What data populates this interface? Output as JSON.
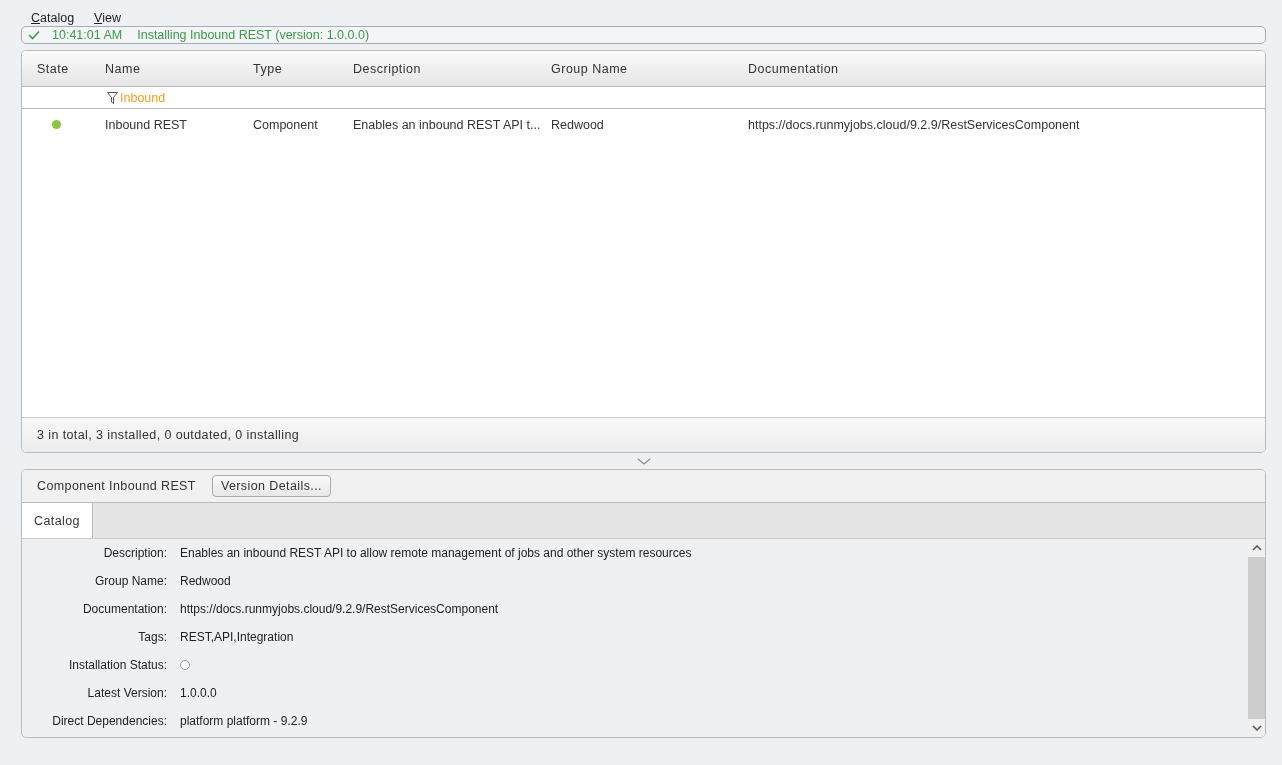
{
  "menu": [
    {
      "label": "Catalog"
    },
    {
      "label": "View"
    }
  ],
  "status_message": {
    "ok": true,
    "time": "10:41:01 AM",
    "text": "Installing Inbound REST (version: 1.0.0.0)"
  },
  "table": {
    "columns": [
      "State",
      "Name",
      "Type",
      "Description",
      "Group Name",
      "Documentation"
    ],
    "filter": "Inbound",
    "rows": [
      {
        "cells": [
          {
            "kind": "dot",
            "color": "#8cc63f"
          },
          "Inbound REST",
          "Component",
          "Enables an inbound REST API t...",
          "Redwood",
          "https://docs.runmyjobs.cloud/9.2.9/RestServicesComponent"
        ]
      }
    ],
    "summary": "3 in total, 3 installed, 0 outdated, 0 installing"
  },
  "details": {
    "title": "Component Inbound REST",
    "button": "Version Details...",
    "tabs": [
      {
        "label": "Catalog",
        "selected": true
      }
    ],
    "fields": [
      {
        "kind": "text",
        "label": "Description:",
        "value": "Enables an inbound REST API to allow remote management of jobs and other system resources"
      },
      {
        "kind": "text",
        "label": "Group Name:",
        "value": "Redwood"
      },
      {
        "kind": "text",
        "label": "Documentation:",
        "value": "https://docs.runmyjobs.cloud/9.2.9/RestServicesComponent"
      },
      {
        "kind": "text",
        "label": "Tags:",
        "value": "REST,API,Integration"
      },
      {
        "kind": "status",
        "label": "Installation Status:",
        "installed": false
      },
      {
        "kind": "text",
        "label": "Latest Version:",
        "value": "1.0.0.0"
      },
      {
        "kind": "text",
        "label": "Direct Dependencies:",
        "value": "platform platform - 9.2.9"
      }
    ]
  }
}
